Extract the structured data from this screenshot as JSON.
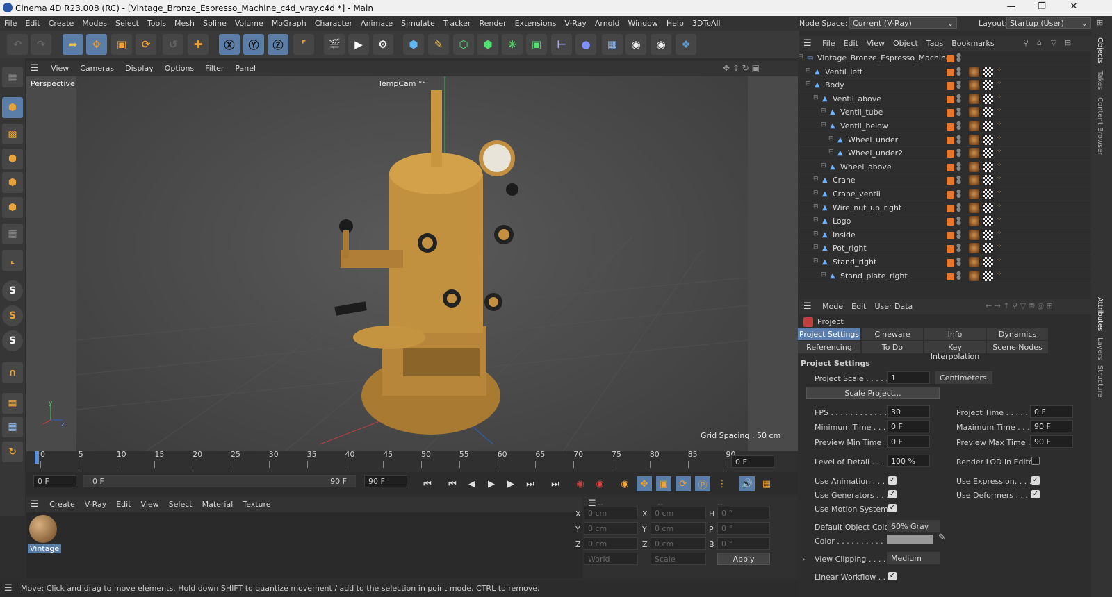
{
  "window": {
    "title": "Cinema 4D R23.008 (RC) - [Vintage_Bronze_Espresso_Machine_c4d_vray.c4d *] - Main"
  },
  "menubar": [
    "File",
    "Edit",
    "Create",
    "Modes",
    "Select",
    "Tools",
    "Mesh",
    "Spline",
    "Volume",
    "MoGraph",
    "Character",
    "Animate",
    "Simulate",
    "Tracker",
    "Render",
    "Extensions",
    "V-Ray",
    "Arnold",
    "Window",
    "Help",
    "3DToAll"
  ],
  "nodespace": {
    "label": "Node Space:",
    "value": "Current (V-Ray)"
  },
  "layout": {
    "label": "Layout:",
    "value": "Startup (User)"
  },
  "viewport": {
    "menu": [
      "View",
      "Cameras",
      "Display",
      "Options",
      "Filter",
      "Panel"
    ],
    "label": "Perspective",
    "camera": "TempCam °°",
    "grid": "Grid Spacing : 50 cm"
  },
  "timeline": {
    "ticks": [
      "0",
      "5",
      "10",
      "15",
      "20",
      "25",
      "30",
      "35",
      "40",
      "45",
      "50",
      "55",
      "60",
      "65",
      "70",
      "75",
      "80",
      "85",
      "90"
    ],
    "current": "0 F",
    "start": "0 F",
    "range_start": "0 F",
    "range_end": "90 F",
    "end": "90 F"
  },
  "material": {
    "menu": [
      "Create",
      "V-Ray",
      "Edit",
      "View",
      "Select",
      "Material",
      "Texture"
    ],
    "name": "Vintage"
  },
  "coords": {
    "header": [
      "--",
      "--",
      "--"
    ],
    "x": "0 cm",
    "y": "0 cm",
    "z": "0 cm",
    "x2": "0 cm",
    "y2": "0 cm",
    "z2": "0 cm",
    "h": "0 °",
    "p": "0 °",
    "b": "0 °",
    "mode1": "World",
    "mode2": "Scale",
    "apply": "Apply"
  },
  "status": "Move: Click and drag to move elements. Hold down SHIFT to quantize movement / add to the selection in point mode, CTRL to remove.",
  "objmgr": {
    "menu": [
      "File",
      "Edit",
      "View",
      "Object",
      "Tags",
      "Bookmarks"
    ],
    "objects": [
      {
        "name": "Vintage_Bronze_Espresso_Machine",
        "indent": 0,
        "root": true
      },
      {
        "name": "Ventil_left",
        "indent": 1
      },
      {
        "name": "Body",
        "indent": 1
      },
      {
        "name": "Ventil_above",
        "indent": 2
      },
      {
        "name": "Ventil_tube",
        "indent": 3
      },
      {
        "name": "Ventil_below",
        "indent": 3
      },
      {
        "name": "Wheel_under",
        "indent": 4
      },
      {
        "name": "Wheel_under2",
        "indent": 4
      },
      {
        "name": "Wheel_above",
        "indent": 3
      },
      {
        "name": "Crane",
        "indent": 2
      },
      {
        "name": "Crane_ventil",
        "indent": 2
      },
      {
        "name": "Wire_nut_up_right",
        "indent": 2
      },
      {
        "name": "Logo",
        "indent": 2
      },
      {
        "name": "Inside",
        "indent": 2
      },
      {
        "name": "Pot_right",
        "indent": 2
      },
      {
        "name": "Stand_right",
        "indent": 2
      },
      {
        "name": "Stand_plate_right",
        "indent": 3
      }
    ]
  },
  "attrs": {
    "menu": [
      "Mode",
      "Edit",
      "User Data"
    ],
    "project": "Project",
    "tabs1": [
      "Project Settings",
      "Cineware",
      "Info",
      "Dynamics"
    ],
    "tabs2": [
      "Referencing",
      "To Do",
      "Key Interpolation",
      "Scene Nodes"
    ],
    "section": "Project Settings",
    "project_scale_label": "Project Scale . . . . .",
    "project_scale": "1",
    "scale_unit": "Centimeters",
    "scale_btn": "Scale Project...",
    "fps_label": "FPS . . . . . . . . . . . .",
    "fps": "30",
    "ptime_label": "Project Time . . . . .",
    "ptime": "0 F",
    "mintime_label": "Minimum Time . . .",
    "mintime": "0 F",
    "maxtime_label": "Maximum Time . . .",
    "maxtime": "90 F",
    "pmin_label": "Preview Min Time . .",
    "pmin": "0 F",
    "pmax_label": "Preview Max Time . .",
    "pmax": "90 F",
    "lod_label": "Level of Detail . . . . .",
    "lod": "100 %",
    "rlod_label": "Render LOD in Editor",
    "useanim": "Use Animation . . . .",
    "useexpr": "Use Expression. . . .",
    "usegen": "Use Generators . . .",
    "usedef": "Use Deformers . . . .",
    "usemotion": "Use Motion System",
    "doc_label": "Default Object Color",
    "doc": "60% Gray",
    "color_label": "Color . . . . . . . . . .",
    "clip_label": "View Clipping . . . .",
    "clip": "Medium",
    "linear": "Linear Workflow . . ."
  },
  "sidetabs": {
    "obj": [
      "Objects",
      "Takes",
      "Content Browser"
    ],
    "attr": [
      "Attributes",
      "Layers",
      "Structure"
    ]
  },
  "colors": {
    "accent": "#5a7fae",
    "orange": "#e8772e",
    "bronze": "#b8863a"
  }
}
